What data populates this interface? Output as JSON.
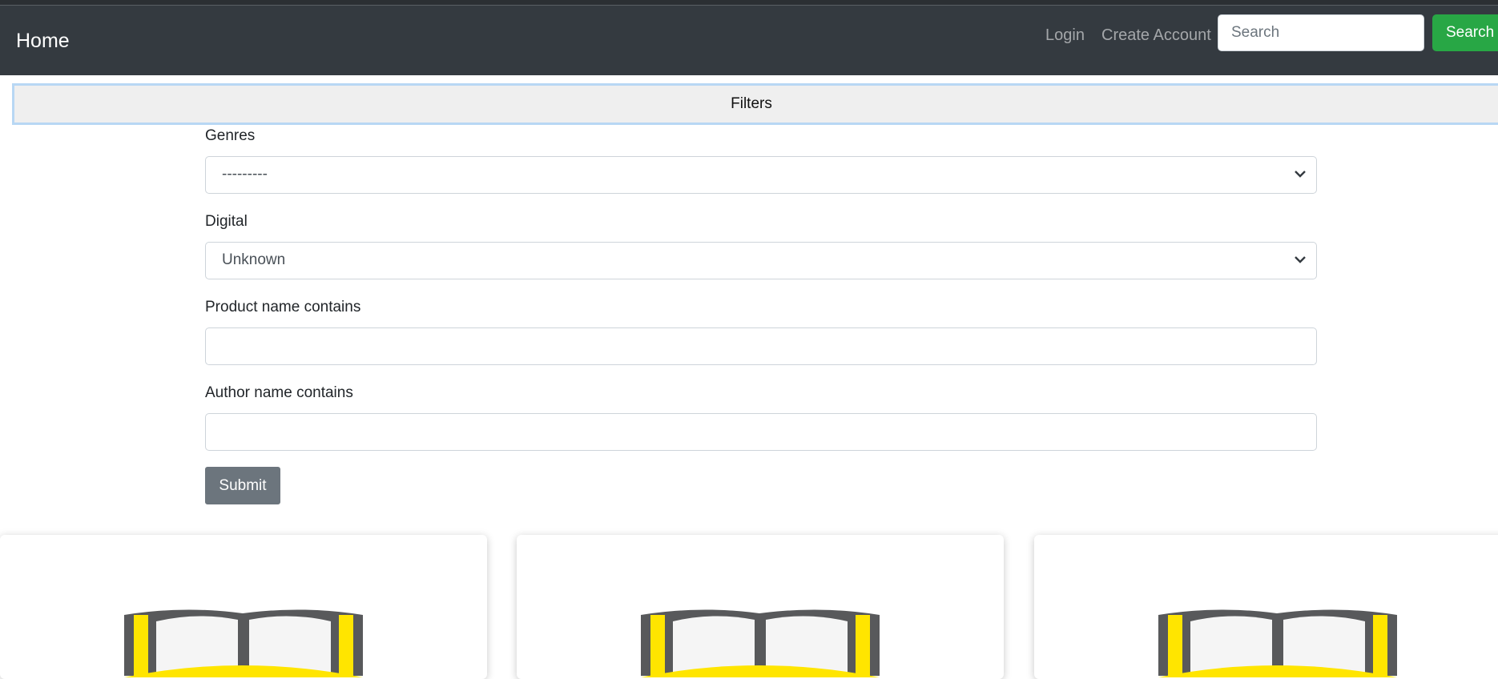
{
  "navbar": {
    "brand": "Home",
    "links": [
      "Login",
      "Create Account"
    ],
    "search": {
      "placeholder": "Search",
      "value": ""
    },
    "search_button": "Search"
  },
  "filters": {
    "title": "Filters",
    "genres": {
      "label": "Genres",
      "selected": "---------"
    },
    "digital": {
      "label": "Digital",
      "selected": "Unknown"
    },
    "product_name": {
      "label": "Product name contains",
      "value": ""
    },
    "author_name": {
      "label": "Author name contains",
      "value": ""
    },
    "submit": "Submit"
  },
  "cards": [
    {
      "icon": "book-icon"
    },
    {
      "icon": "book-icon"
    },
    {
      "icon": "book-icon"
    }
  ],
  "colors": {
    "navbar": "#343a40",
    "search_button": "#28a745",
    "submit_button": "#6c757d",
    "filters_bar": "#efefef",
    "filters_border": "#b8d7f4",
    "book_yellow": "#ffe500",
    "book_outline": "#58595b"
  }
}
